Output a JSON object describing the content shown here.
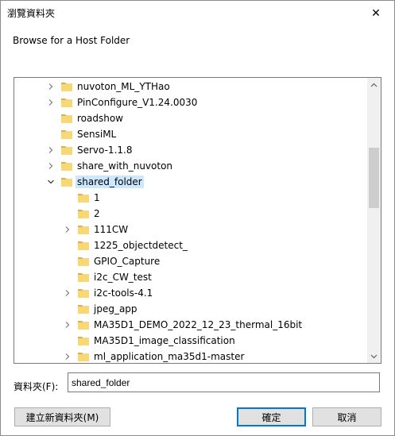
{
  "window": {
    "title": "瀏覽資料夾",
    "close_glyph": "✕"
  },
  "prompt": "Browse for a Host Folder",
  "tree": {
    "items": [
      {
        "label": "nuvoton_ML_YTHao",
        "expandable": true,
        "expanded": false,
        "level": 1,
        "selected": false
      },
      {
        "label": "PinConfigure_V1.24.0030",
        "expandable": true,
        "expanded": false,
        "level": 1,
        "selected": false
      },
      {
        "label": "roadshow",
        "expandable": false,
        "expanded": false,
        "level": 1,
        "selected": false
      },
      {
        "label": "SensiML",
        "expandable": false,
        "expanded": false,
        "level": 1,
        "selected": false
      },
      {
        "label": "Servo-1.1.8",
        "expandable": true,
        "expanded": false,
        "level": 1,
        "selected": false
      },
      {
        "label": "share_with_nuvoton",
        "expandable": true,
        "expanded": false,
        "level": 1,
        "selected": false
      },
      {
        "label": "shared_folder",
        "expandable": true,
        "expanded": true,
        "level": 1,
        "selected": true
      },
      {
        "label": "1",
        "expandable": false,
        "expanded": false,
        "level": 2,
        "selected": false
      },
      {
        "label": "2",
        "expandable": false,
        "expanded": false,
        "level": 2,
        "selected": false
      },
      {
        "label": "111CW",
        "expandable": true,
        "expanded": false,
        "level": 2,
        "selected": false
      },
      {
        "label": "1225_objectdetect_",
        "expandable": false,
        "expanded": false,
        "level": 2,
        "selected": false
      },
      {
        "label": "GPIO_Capture",
        "expandable": false,
        "expanded": false,
        "level": 2,
        "selected": false
      },
      {
        "label": "i2c_CW_test",
        "expandable": false,
        "expanded": false,
        "level": 2,
        "selected": false
      },
      {
        "label": "i2c-tools-4.1",
        "expandable": true,
        "expanded": false,
        "level": 2,
        "selected": false
      },
      {
        "label": "jpeg_app",
        "expandable": false,
        "expanded": false,
        "level": 2,
        "selected": false
      },
      {
        "label": "MA35D1_DEMO_2022_12_23_thermal_16bit",
        "expandable": true,
        "expanded": false,
        "level": 2,
        "selected": false
      },
      {
        "label": "MA35D1_image_classification",
        "expandable": false,
        "expanded": false,
        "level": 2,
        "selected": false
      },
      {
        "label": "ml_application_ma35d1-master",
        "expandable": true,
        "expanded": false,
        "level": 2,
        "selected": false
      }
    ]
  },
  "folder_field": {
    "label": "資料夾(F):",
    "value": "shared_folder"
  },
  "buttons": {
    "new_folder": "建立新資料夾(M)",
    "ok": "確定",
    "cancel": "取消"
  },
  "colors": {
    "folder_yellow": "#f8d775",
    "selection": "#cce8ff",
    "default_button_border": "#0078d7"
  }
}
